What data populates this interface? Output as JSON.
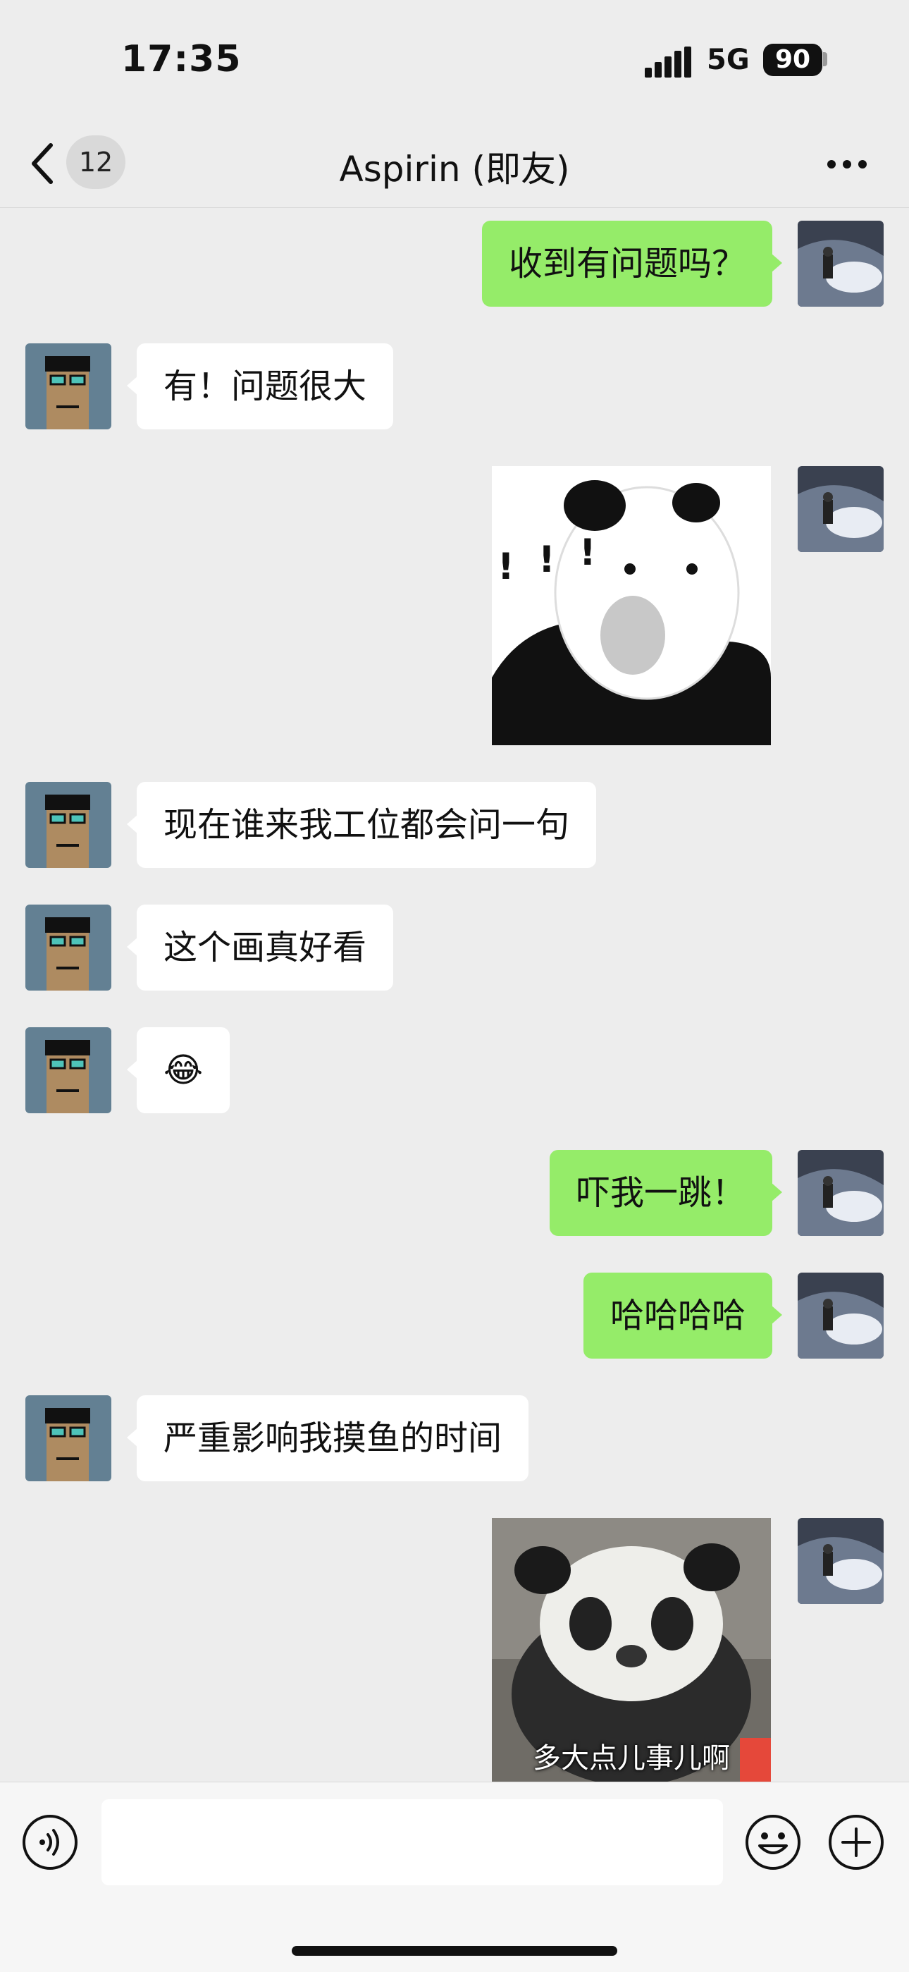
{
  "status_bar": {
    "time": "17:35",
    "network": "5G",
    "battery": "90"
  },
  "nav": {
    "unread_count": "12",
    "title": "Aspirin (即友)"
  },
  "messages": [
    {
      "side": "out",
      "type": "text",
      "text": "收到有问题吗？"
    },
    {
      "side": "in",
      "type": "text",
      "text": "有！问题很大"
    },
    {
      "side": "out",
      "type": "sticker",
      "sticker": "panda-meme-exclaim"
    },
    {
      "side": "in",
      "type": "text",
      "text": "现在谁来我工位都会问一句"
    },
    {
      "side": "in",
      "type": "text",
      "text": "这个画真好看"
    },
    {
      "side": "in",
      "type": "text",
      "text": "😂"
    },
    {
      "side": "out",
      "type": "text",
      "text": "吓我一跳！"
    },
    {
      "side": "out",
      "type": "text",
      "text": "哈哈哈哈"
    },
    {
      "side": "in",
      "type": "text",
      "text": "严重影响我摸鱼的时间"
    },
    {
      "side": "out",
      "type": "sticker",
      "sticker": "panda-photo",
      "caption": "多大点儿事儿啊"
    }
  ],
  "input_bar": {
    "placeholder": ""
  },
  "colors": {
    "outgoing_bubble": "#95ec69",
    "incoming_bubble": "#ffffff",
    "background": "#ededed"
  },
  "icons": [
    "signal-icon",
    "back-chevron-icon",
    "more-icon",
    "voice-icon",
    "emoji-icon",
    "plus-icon"
  ]
}
